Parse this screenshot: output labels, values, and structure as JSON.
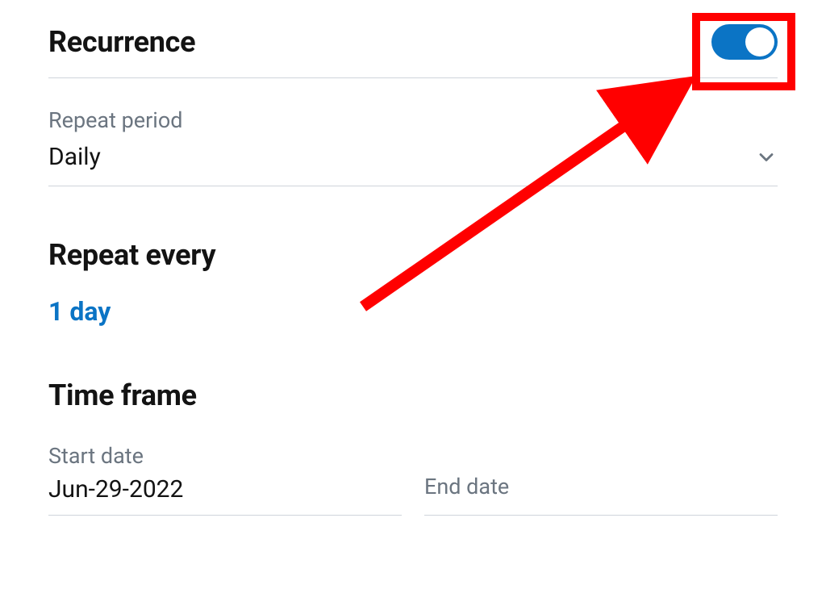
{
  "recurrence": {
    "title": "Recurrence",
    "toggle_on": true,
    "repeat_period_label": "Repeat period",
    "repeat_period_value": "Daily"
  },
  "repeat_every": {
    "heading": "Repeat every",
    "value": "1 day"
  },
  "time_frame": {
    "heading": "Time frame",
    "start_date_label": "Start date",
    "start_date_value": "Jun-29-2022",
    "end_date_label": "End date",
    "end_date_value": ""
  },
  "annotation": {
    "highlight": "recurrence-toggle",
    "color": "#ff0000"
  }
}
